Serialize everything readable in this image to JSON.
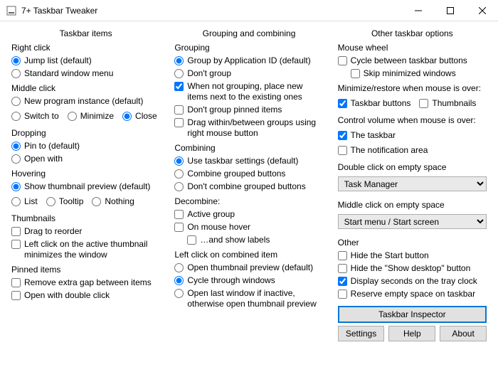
{
  "window": {
    "title": "7+ Taskbar Tweaker"
  },
  "col1": {
    "header": "Taskbar items",
    "right_click": {
      "title": "Right click",
      "jump_list": "Jump list (default)",
      "std_menu": "Standard window menu"
    },
    "middle_click": {
      "title": "Middle click",
      "new_inst": "New program instance (default)",
      "switch_to": "Switch to",
      "minimize": "Minimize",
      "close": "Close"
    },
    "dropping": {
      "title": "Dropping",
      "pin_to": "Pin to (default)",
      "open_with": "Open with"
    },
    "hovering": {
      "title": "Hovering",
      "thumb": "Show thumbnail preview (default)",
      "list": "List",
      "tooltip": "Tooltip",
      "nothing": "Nothing"
    },
    "thumbs": {
      "title": "Thumbnails",
      "drag": "Drag to reorder",
      "leftclick": "Left click on the active thumbnail minimizes the window"
    },
    "pinned": {
      "title": "Pinned items",
      "gap": "Remove extra gap between items",
      "dbl": "Open with double click"
    }
  },
  "col2": {
    "header": "Grouping and combining",
    "grouping": {
      "title": "Grouping",
      "appid": "Group by Application ID (default)",
      "dont": "Don't group",
      "nextto": "When not grouping, place new items next to the existing ones",
      "nopinned": "Don't group pinned items",
      "drag": "Drag within/between groups using right mouse button"
    },
    "combining": {
      "title": "Combining",
      "use": "Use taskbar settings (default)",
      "combine": "Combine grouped buttons",
      "dont": "Don't combine grouped buttons"
    },
    "decombine": {
      "title": "Decombine:",
      "active": "Active group",
      "hover": "On mouse hover",
      "labels": "…and show labels"
    },
    "leftclick": {
      "title": "Left click on combined item",
      "open": "Open thumbnail preview (default)",
      "cycle": "Cycle through windows",
      "last": "Open last window if inactive, otherwise open thumbnail preview"
    }
  },
  "col3": {
    "header": "Other taskbar options",
    "wheel": {
      "title": "Mouse wheel",
      "cycle": "Cycle between taskbar buttons",
      "skip": "Skip minimized windows"
    },
    "minrest": {
      "title": "Minimize/restore when mouse is over:",
      "tb": "Taskbar buttons",
      "th": "Thumbnails"
    },
    "volume": {
      "title": "Control volume when mouse is over:",
      "taskbar": "The taskbar",
      "notif": "The notification area"
    },
    "dblclick": {
      "title": "Double click on empty space",
      "value": "Task Manager"
    },
    "midclick": {
      "title": "Middle click on empty space",
      "value": "Start menu / Start screen"
    },
    "other": {
      "title": "Other",
      "hidestart": "Hide the Start button",
      "hidedesktop": "Hide the \"Show desktop\" button",
      "seconds": "Display seconds on the tray clock",
      "reserve": "Reserve empty space on taskbar"
    },
    "buttons": {
      "inspector": "Taskbar Inspector",
      "settings": "Settings",
      "help": "Help",
      "about": "About"
    }
  }
}
